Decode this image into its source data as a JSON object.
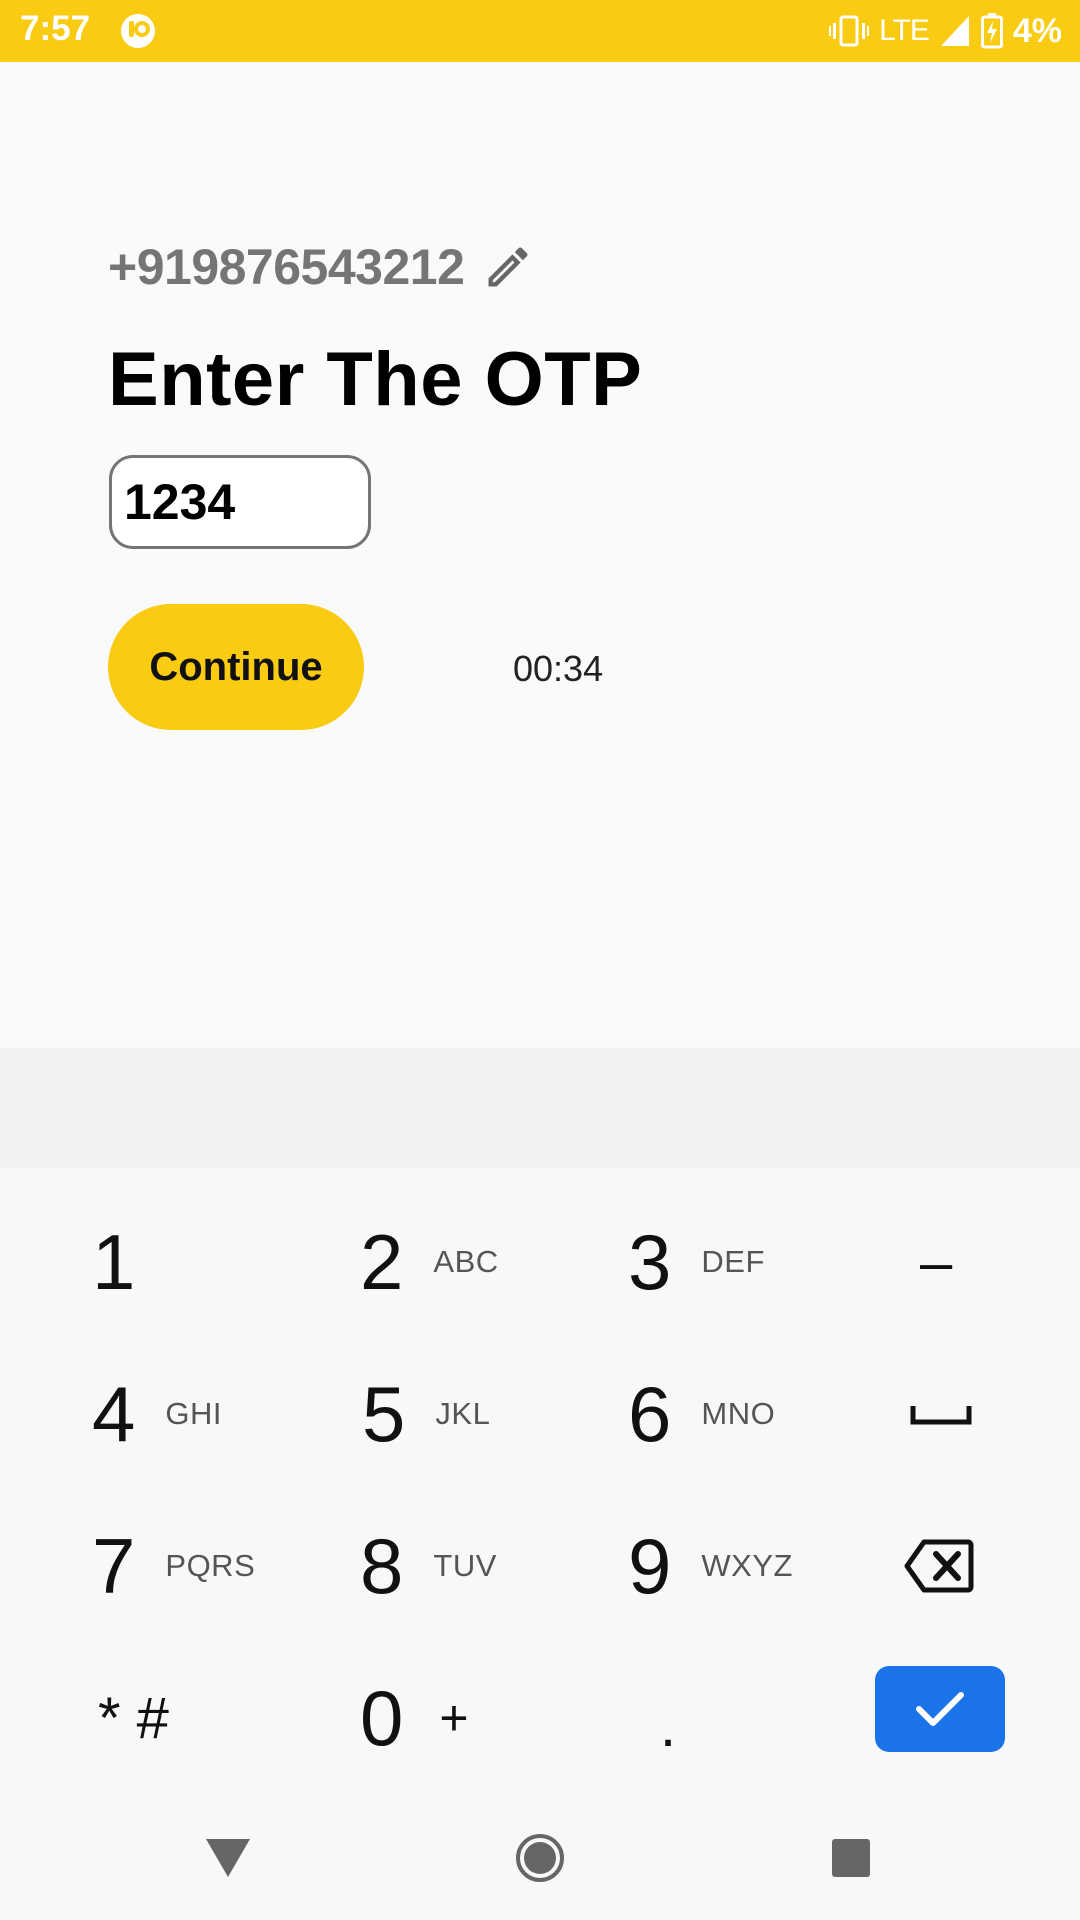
{
  "status_bar": {
    "time": "7:57",
    "network": "LTE",
    "battery": "4%",
    "icons": [
      "app-notification-icon",
      "vibrate-icon",
      "signal-icon",
      "battery-charging-icon"
    ],
    "color": "#f9cb12"
  },
  "login": {
    "phone_number": "+919876543212",
    "edit_icon": "pencil-icon",
    "title": "Enter The OTP",
    "otp_value": "1234",
    "continue_label": "Continue",
    "timer": "00:34",
    "accent_color": "#f9cb12"
  },
  "keyboard": {
    "rows": [
      [
        {
          "digit": "1",
          "letters": ""
        },
        {
          "digit": "2",
          "letters": "ABC"
        },
        {
          "digit": "3",
          "letters": "DEF"
        },
        {
          "symbol": "–"
        }
      ],
      [
        {
          "digit": "4",
          "letters": "GHI"
        },
        {
          "digit": "5",
          "letters": "JKL"
        },
        {
          "digit": "6",
          "letters": "MNO"
        },
        {
          "icon": "space-icon"
        }
      ],
      [
        {
          "digit": "7",
          "letters": "PQRS"
        },
        {
          "digit": "8",
          "letters": "TUV"
        },
        {
          "digit": "9",
          "letters": "WXYZ"
        },
        {
          "icon": "backspace-icon"
        }
      ],
      [
        {
          "symbol": "* #"
        },
        {
          "digit": "0",
          "letters": "+"
        },
        {
          "symbol": "."
        },
        {
          "icon": "check-icon"
        }
      ]
    ],
    "done_color": "#1a73e8"
  },
  "nav_bar": {
    "icons": [
      "back-triangle-icon",
      "home-circle-icon",
      "recents-square-icon"
    ]
  }
}
